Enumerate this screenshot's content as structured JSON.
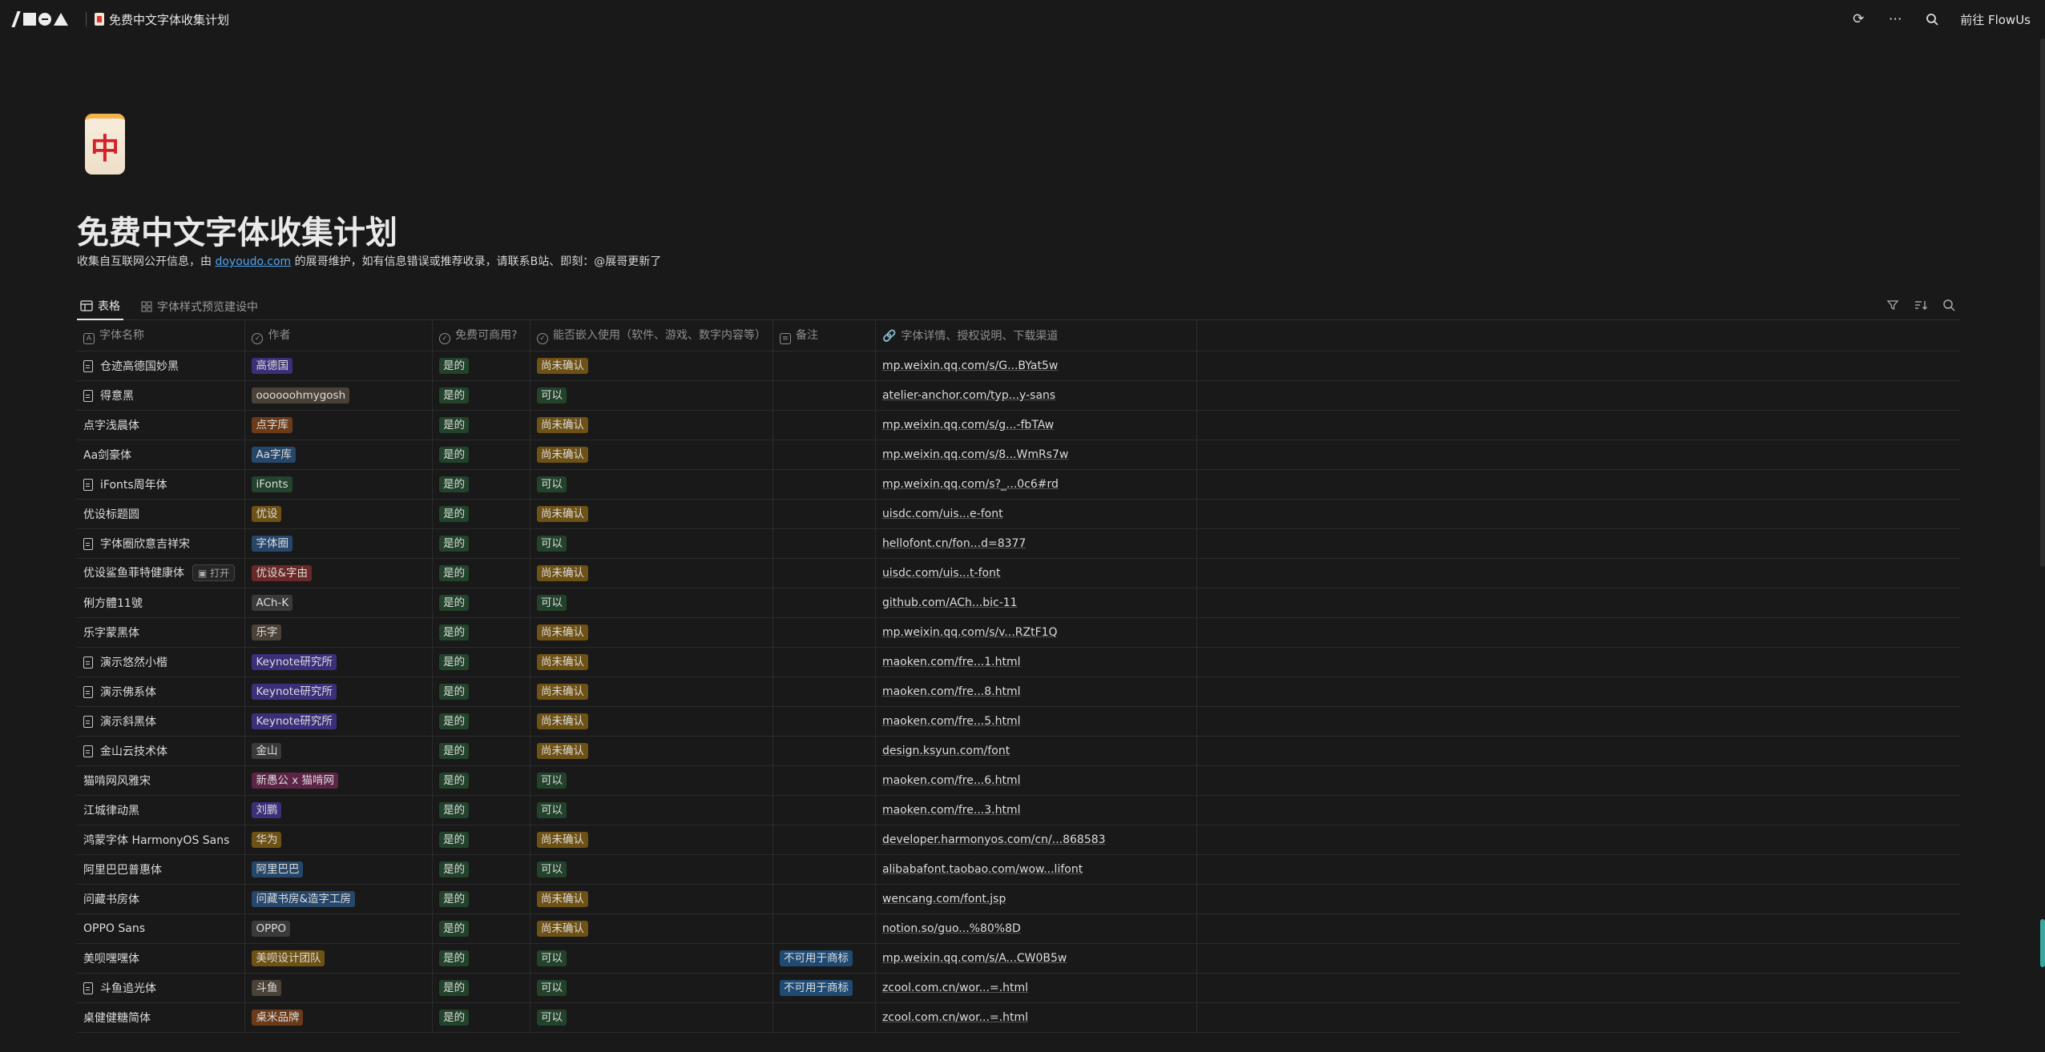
{
  "topbar": {
    "breadcrumb": "免费中文字体收集计划",
    "goto_label": "前往 FlowUs",
    "icons": [
      "flowus-logo",
      "sync-icon",
      "more-icon",
      "search-icon"
    ]
  },
  "page": {
    "icon": "中",
    "title": "免费中文字体收集计划",
    "desc_before": "收集自互联网公开信息，由 ",
    "desc_link": "doyoudo.com",
    "desc_after": " 的展哥维护，如有信息错误或推荐收录，请联系B站、即刻：@展哥更新了"
  },
  "views": {
    "tabs": [
      "表格",
      "字体样式预览建设中"
    ],
    "tools": [
      "filter-icon",
      "sort-icon",
      "search-icon"
    ]
  },
  "table": {
    "columns": [
      "字体名称",
      "作者",
      "免费可商用?",
      "能否嵌入使用（软件、游戏、数字内容等）",
      "备注",
      "字体详情、授权说明、下载渠道"
    ],
    "open_label": "打开",
    "rows": [
      {
        "name": "仓迹高德国妙黑",
        "doc": true,
        "author": "高德国",
        "ac": "#3b2f79",
        "free": "是的",
        "embed": "尚未确认",
        "note": "",
        "link": "mp.weixin.qq.com/s/G...BYat5w"
      },
      {
        "name": "得意黑",
        "doc": true,
        "author": "oooooohmygosh",
        "ac": "#4a4237",
        "free": "是的",
        "embed": "可以",
        "note": "",
        "link": "atelier-anchor.com/typ...y-sans"
      },
      {
        "name": "点字浅晨体",
        "doc": false,
        "author": "点字库",
        "ac": "#6b3b19",
        "free": "是的",
        "embed": "尚未确认",
        "note": "",
        "link": "mp.weixin.qq.com/s/g...-fbTAw"
      },
      {
        "name": "Aa剑豪体",
        "doc": false,
        "author": "Aa字库",
        "ac": "#26476a",
        "free": "是的",
        "embed": "尚未确认",
        "note": "",
        "link": "mp.weixin.qq.com/s/8...WmRs7w"
      },
      {
        "name": "iFonts周年体",
        "doc": true,
        "author": "iFonts",
        "ac": "#23432c",
        "free": "是的",
        "embed": "可以",
        "note": "",
        "link": "mp.weixin.qq.com/s?_...0c6#rd"
      },
      {
        "name": "优设标题圆",
        "doc": false,
        "author": "优设",
        "ac": "#6e5114",
        "free": "是的",
        "embed": "尚未确认",
        "note": "",
        "link": "uisdc.com/uis...e-font"
      },
      {
        "name": "字体圈欣意吉祥宋",
        "doc": true,
        "author": "字体圈",
        "ac": "#26476a",
        "free": "是的",
        "embed": "可以",
        "note": "",
        "link": "hellofont.cn/fon...d=8377"
      },
      {
        "name": "优设鲨鱼菲特健康体",
        "doc": false,
        "author": "优设&字由",
        "ac": "#6a2828",
        "free": "是的",
        "embed": "尚未确认",
        "note": "",
        "link": "uisdc.com/uis...t-font",
        "open": true
      },
      {
        "name": "俐方體11號",
        "doc": false,
        "author": "ACh-K",
        "ac": "#3a3a3a",
        "free": "是的",
        "embed": "可以",
        "note": "",
        "link": "github.com/ACh...bic-11"
      },
      {
        "name": "乐字蒙黑体",
        "doc": false,
        "author": "乐字",
        "ac": "#4a4237",
        "free": "是的",
        "embed": "尚未确认",
        "note": "",
        "link": "mp.weixin.qq.com/s/v...RZtF1Q"
      },
      {
        "name": "演示悠然小楷",
        "doc": true,
        "author": "Keynote研究所",
        "ac": "#3b2f79",
        "free": "是的",
        "embed": "尚未确认",
        "note": "",
        "link": "maoken.com/fre...1.html"
      },
      {
        "name": "演示佛系体",
        "doc": true,
        "author": "Keynote研究所",
        "ac": "#3b2f79",
        "free": "是的",
        "embed": "尚未确认",
        "note": "",
        "link": "maoken.com/fre...8.html"
      },
      {
        "name": "演示斜黑体",
        "doc": true,
        "author": "Keynote研究所",
        "ac": "#3b2f79",
        "free": "是的",
        "embed": "尚未确认",
        "note": "",
        "link": "maoken.com/fre...5.html"
      },
      {
        "name": "金山云技术体",
        "doc": true,
        "author": "金山",
        "ac": "#3a3a3a",
        "free": "是的",
        "embed": "尚未确认",
        "note": "",
        "link": "design.ksyun.com/font"
      },
      {
        "name": "猫啃网风雅宋",
        "doc": false,
        "author": "新愚公 x 猫啃网",
        "ac": "#5c2446",
        "free": "是的",
        "embed": "可以",
        "note": "",
        "link": "maoken.com/fre...6.html"
      },
      {
        "name": "江城律动黑",
        "doc": false,
        "author": "刘鹏",
        "ac": "#3b2f79",
        "free": "是的",
        "embed": "可以",
        "note": "",
        "link": "maoken.com/fre...3.html"
      },
      {
        "name": "鸿蒙字体 HarmonyOS Sans",
        "doc": false,
        "author": "华为",
        "ac": "#6e5114",
        "free": "是的",
        "embed": "尚未确认",
        "note": "",
        "link": "developer.harmonyos.com/cn/...868583"
      },
      {
        "name": "阿里巴巴普惠体",
        "doc": false,
        "author": "阿里巴巴",
        "ac": "#26476a",
        "free": "是的",
        "embed": "可以",
        "note": "",
        "link": "alibabafont.taobao.com/wow...lifont"
      },
      {
        "name": "问藏书房体",
        "doc": false,
        "author": "问藏书房&造字工房",
        "ac": "#26476a",
        "free": "是的",
        "embed": "尚未确认",
        "note": "",
        "link": "wencang.com/font.jsp"
      },
      {
        "name": "OPPO Sans",
        "doc": false,
        "author": "OPPO",
        "ac": "#3a3a3a",
        "free": "是的",
        "embed": "尚未确认",
        "note": "",
        "link": "notion.so/guo...%80%8D"
      },
      {
        "name": "美呗嘿嘿体",
        "doc": false,
        "author": "美呗设计团队",
        "ac": "#6e5114",
        "free": "是的",
        "embed": "可以",
        "note": "不可用于商标",
        "link": "mp.weixin.qq.com/s/A...CW0B5w"
      },
      {
        "name": "斗鱼追光体",
        "doc": true,
        "author": "斗鱼",
        "ac": "#4a4237",
        "free": "是的",
        "embed": "可以",
        "note": "不可用于商标",
        "link": "zcool.com.cn/wor...=.html"
      },
      {
        "name": "桌健健糖简体",
        "doc": false,
        "author": "桌米品牌",
        "ac": "#6b3b19",
        "free": "是的",
        "embed": "可以",
        "note": "",
        "link": "zcool.com.cn/wor...=.html"
      }
    ]
  },
  "colors": {
    "free_bg": "#22422b",
    "embed_yes_bg": "#22422b",
    "embed_pending_bg": "#6e5114",
    "note_bg": "#1f4a74",
    "link": "#4ea3f0"
  }
}
